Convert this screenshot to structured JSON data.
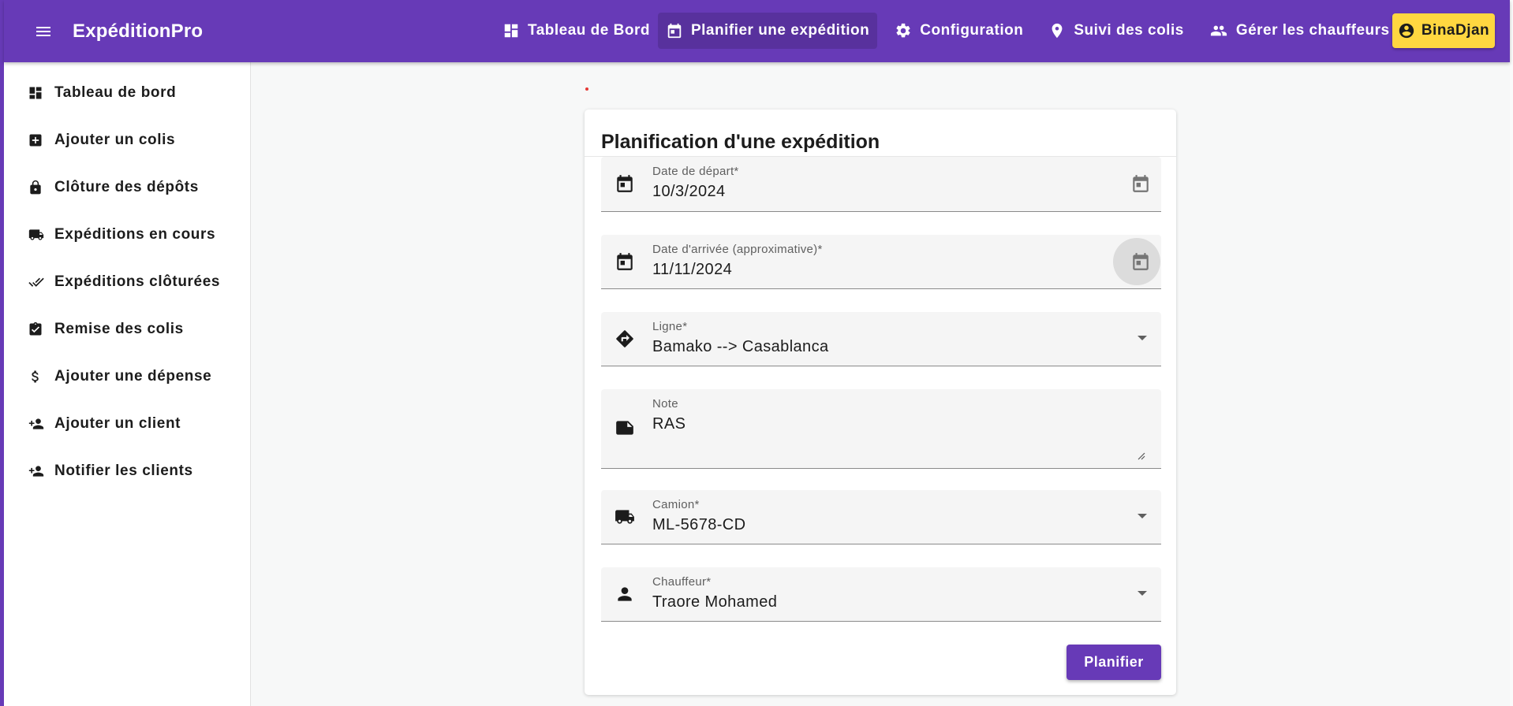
{
  "app": {
    "brand": "ExpéditionPro"
  },
  "colors": {
    "primary": "#673ab7",
    "accent": "#ffd740",
    "background": "#f7f8f8"
  },
  "topnav": {
    "items": [
      {
        "label": "Tableau de Bord",
        "icon": "dashboard-icon"
      },
      {
        "label": "Planifier une expédition",
        "icon": "calendar-icon",
        "active": true
      },
      {
        "label": "Configuration",
        "icon": "gear-icon"
      },
      {
        "label": "Suivi des colis",
        "icon": "location-pin-icon"
      },
      {
        "label": "Gérer les chauffeurs",
        "icon": "people-icon"
      }
    ],
    "user": {
      "label": "BinaDjan",
      "icon": "account-circle-icon"
    }
  },
  "sidebar": {
    "items": [
      {
        "label": "Tableau de bord",
        "icon": "dashboard-icon"
      },
      {
        "label": "Ajouter un colis",
        "icon": "add-box-icon"
      },
      {
        "label": "Clôture des dépôts",
        "icon": "lock-icon"
      },
      {
        "label": "Expéditions en cours",
        "icon": "truck-icon"
      },
      {
        "label": "Expéditions clôturées",
        "icon": "double-check-icon"
      },
      {
        "label": "Remise des colis",
        "icon": "clipboard-check-icon"
      },
      {
        "label": "Ajouter une dépense",
        "icon": "dollar-icon"
      },
      {
        "label": "Ajouter un client",
        "icon": "person-add-icon"
      },
      {
        "label": "Notifier les clients",
        "icon": "person-add-icon"
      }
    ]
  },
  "form": {
    "title": "Planification d'une expédition",
    "departure": {
      "label": "Date de départ*",
      "value": "10/3/2024"
    },
    "arrival": {
      "label": "Date d'arrivée (approximative)*",
      "value": "11/11/2024"
    },
    "line": {
      "label": "Ligne*",
      "value": "Bamako --> Casablanca"
    },
    "note": {
      "label": "Note",
      "value": "RAS"
    },
    "truck": {
      "label": "Camion*",
      "value": "ML-5678-CD"
    },
    "driver": {
      "label": "Chauffeur*",
      "value": "Traore Mohamed"
    },
    "submit_label": "Planifier"
  }
}
